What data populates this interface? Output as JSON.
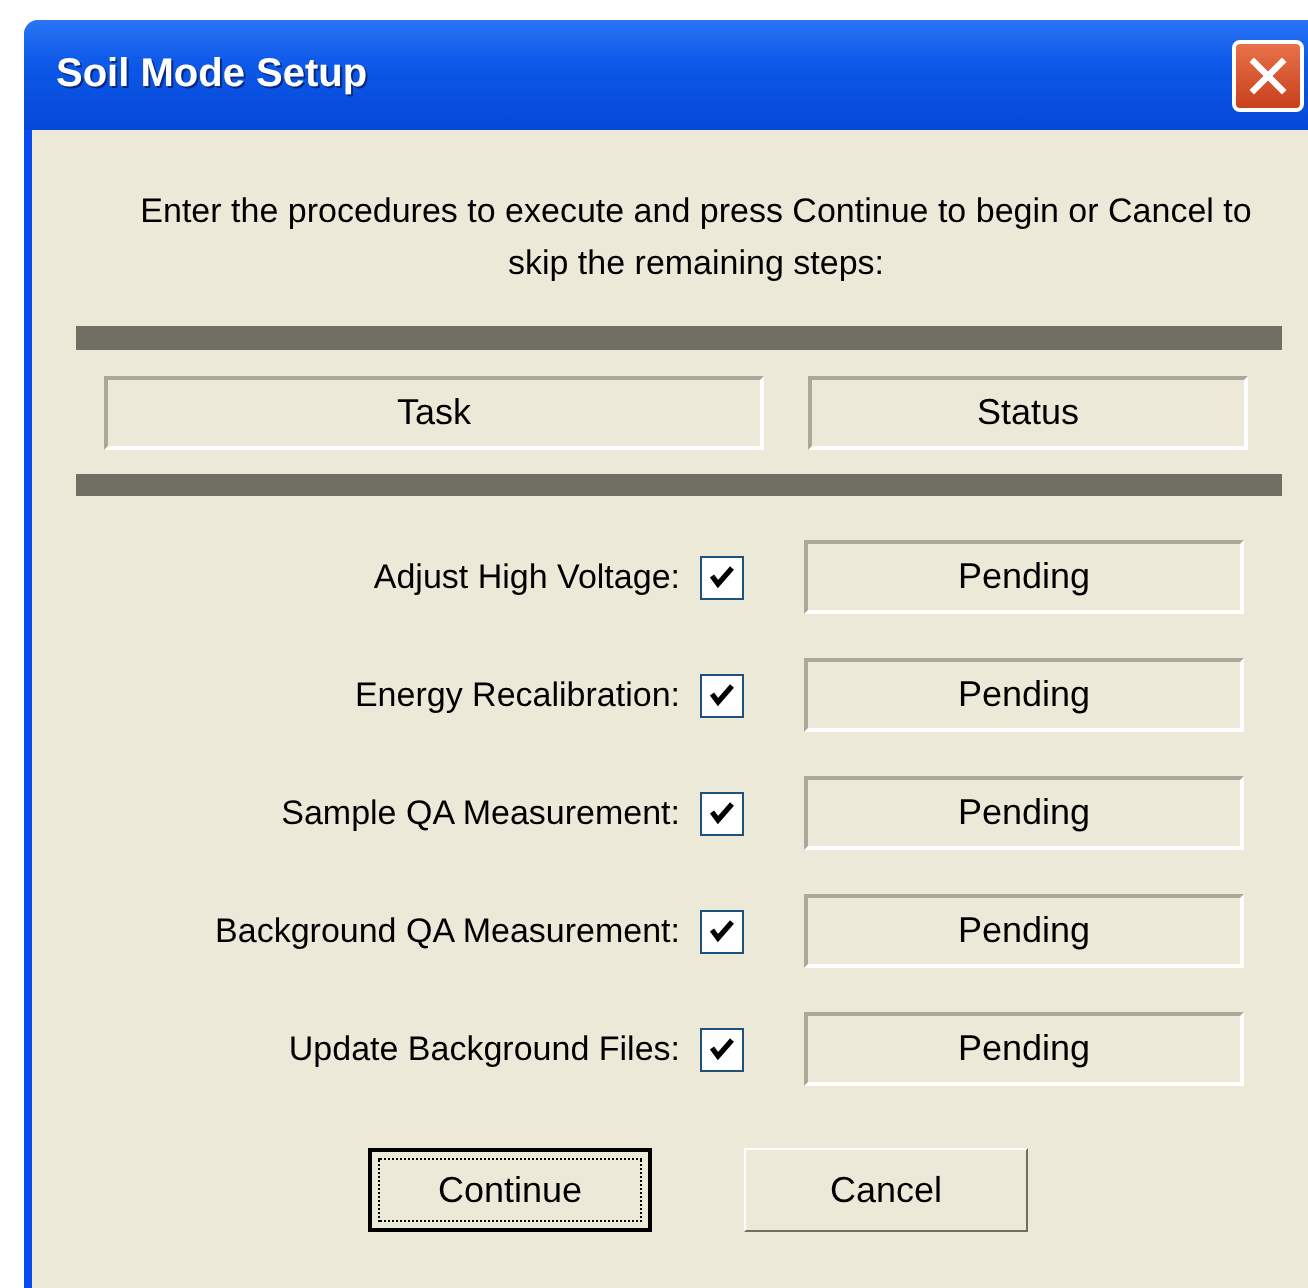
{
  "window": {
    "title": "Soil Mode Setup"
  },
  "instructions": "Enter the procedures to execute and press Continue to begin or Cancel to skip the remaining steps:",
  "columns": [
    "Task",
    "Status"
  ],
  "tasks": [
    {
      "label": "Adjust High Voltage:",
      "checked": true,
      "status": "Pending"
    },
    {
      "label": "Energy Recalibration:",
      "checked": true,
      "status": "Pending"
    },
    {
      "label": "Sample QA Measurement:",
      "checked": true,
      "status": "Pending"
    },
    {
      "label": "Background QA Measurement:",
      "checked": true,
      "status": "Pending"
    },
    {
      "label": "Update Background Files:",
      "checked": true,
      "status": "Pending"
    }
  ],
  "buttons": [
    {
      "label": "Continue",
      "default": true
    },
    {
      "label": "Cancel",
      "default": false
    }
  ]
}
